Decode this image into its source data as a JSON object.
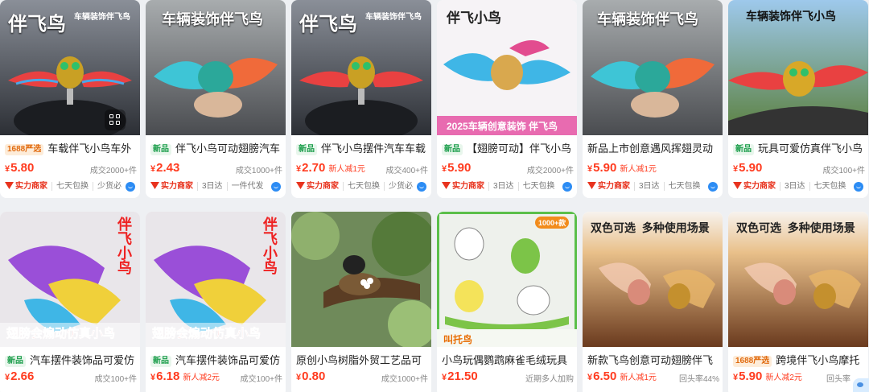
{
  "products": [
    {
      "title": "车载伴飞小鸟车外",
      "tag": "1688严选",
      "tag_type": "1688",
      "price": "5.80",
      "promo": "",
      "sold": "成交2000+件",
      "merchant": "实力商家",
      "chips": [
        "七天包换",
        "少货必"
      ]
    },
    {
      "title": "伴飞小鸟可动翅膀汽车",
      "tag": "新品",
      "tag_type": "new",
      "price": "2.43",
      "promo": "",
      "sold": "成交1000+件",
      "merchant": "实力商家",
      "chips": [
        "3日达",
        "一件代发"
      ]
    },
    {
      "title": "伴飞小鸟摆件汽车车载",
      "tag": "新品",
      "tag_type": "new",
      "price": "2.70",
      "promo": "新人减1元",
      "sold": "成交400+件",
      "merchant": "实力商家",
      "chips": [
        "七天包换",
        "少货必"
      ]
    },
    {
      "title": "【翅膀可动】伴飞小鸟",
      "tag": "新品",
      "tag_type": "new",
      "price": "5.90",
      "promo": "",
      "sold": "成交2000+件",
      "merchant": "实力商家",
      "chips": [
        "3日达",
        "七天包换"
      ]
    },
    {
      "title": "新品上市创意遇风挥翅灵动",
      "tag": "",
      "tag_type": "",
      "price": "5.90",
      "promo": "新人减1元",
      "sold": "",
      "merchant": "实力商家",
      "chips": [
        "3日达",
        "七天包换"
      ]
    },
    {
      "title": "玩具可爱仿真伴飞小鸟",
      "tag": "新品",
      "tag_type": "new",
      "price": "5.90",
      "promo": "",
      "sold": "成交100+件",
      "merchant": "实力商家",
      "chips": [
        "3日达",
        "七天包换"
      ]
    },
    {
      "title": "汽车摆件装饰品可爱仿",
      "tag": "新品",
      "tag_type": "new",
      "price": "2.66",
      "promo": "",
      "sold": "成交100+件",
      "merchant": "",
      "chips": []
    },
    {
      "title": "汽车摆件装饰品可爱仿",
      "tag": "新品",
      "tag_type": "new",
      "price": "6.18",
      "promo": "新人减2元",
      "sold": "成交100+件",
      "merchant": "",
      "chips": []
    },
    {
      "title": "原创小鸟树脂外贸工艺品可",
      "tag": "",
      "tag_type": "",
      "price": "0.80",
      "promo": "",
      "sold": "成交1000+件",
      "merchant": "",
      "chips": []
    },
    {
      "title": "小鸟玩偶鹦鹉麻雀毛绒玩具",
      "tag": "",
      "tag_type": "",
      "price": "21.50",
      "promo": "",
      "sold": "近期多人加购",
      "merchant": "",
      "chips": []
    },
    {
      "title": "新款飞鸟创意可动翅膀伴飞",
      "tag": "",
      "tag_type": "",
      "price": "6.50",
      "promo": "新人减1元",
      "sold": "回头率44%",
      "merchant": "",
      "chips": []
    },
    {
      "title": "跨境伴飞小鸟摩托",
      "tag": "1688严选",
      "tag_type": "1688",
      "price": "5.90",
      "promo": "新人减2元",
      "sold": "回头率",
      "merchant": "",
      "chips": []
    }
  ],
  "images": [
    {
      "headline": "伴飞鸟",
      "sub": "车辆装饰伴飞鸟"
    },
    {
      "headline": "车辆装饰伴飞鸟",
      "sub": ""
    },
    {
      "headline": "伴飞鸟",
      "sub": "车辆装饰伴飞鸟"
    },
    {
      "headline": "伴飞小鸟",
      "sub": "2025车辆创意装饰 伴飞鸟"
    },
    {
      "headline": "车辆装饰伴飞鸟",
      "sub": ""
    },
    {
      "headline": "车辆装饰伴飞小鸟",
      "sub": ""
    },
    {
      "headline": "伴飞小鸟",
      "sub": "翅膀会煽动仿真小鸟"
    },
    {
      "headline": "伴飞小鸟",
      "sub": "翅膀会煽动仿真小鸟"
    },
    {
      "headline": "",
      "sub": ""
    },
    {
      "headline": "1000+款",
      "sub": "叫托鸟"
    },
    {
      "headline": "双色可选  多种使用场景",
      "sub": ""
    },
    {
      "headline": "双色可选  多种使用场景",
      "sub": ""
    }
  ],
  "currency": "¥",
  "colors": {
    "price": "#ff3b1f",
    "merchant": "#e8331e",
    "new_tag": "#1a9d4a",
    "tag_1688": "#e16b10"
  }
}
